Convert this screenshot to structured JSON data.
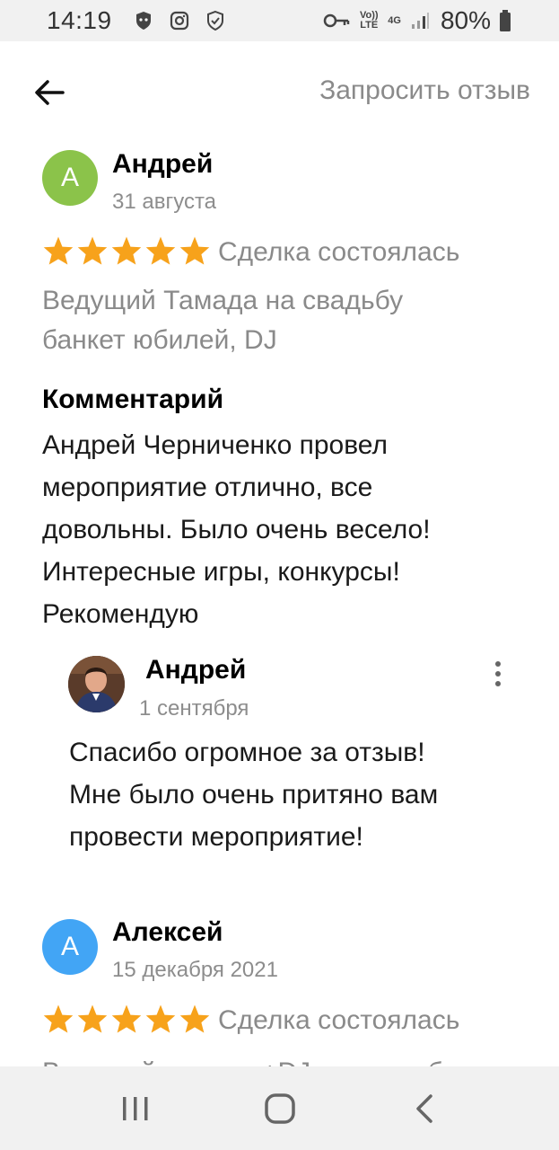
{
  "status_bar": {
    "time": "14:19",
    "network_top": "Vo)) LTE",
    "network_4g": "4G",
    "battery": "80%"
  },
  "header": {
    "request_review_label": "Запросить отзыв"
  },
  "colors": {
    "avatar_andrey": "#8bc34a",
    "avatar_aleksey": "#42a5f5",
    "star": "#f7a21b"
  },
  "reviews": [
    {
      "avatar_letter": "А",
      "author": "Андрей",
      "date": "31 августа",
      "rating": 5,
      "deal_status": "Сделка состоялась",
      "service": "Ведущий Тамада на свадьбу\nбанкет юбилей, DJ",
      "comment_heading": "Комментарий",
      "comment": "Андрей Черниченко провел\nмероприятие отлично, все\nдовольны. Было очень весело!\nИнтересные игры, конкурсы!\nРекомендую",
      "reply": {
        "author": "Андрей",
        "date": "1 сентября",
        "text": "Спасибо огромное за отзыв!\nМне было очень притяно вам\nпровести мероприятие!"
      }
    },
    {
      "avatar_letter": "А",
      "author": "Алексей",
      "date": "15 декабря 2021",
      "rating": 5,
      "deal_status": "Сделка состоялась",
      "service": "Ведущий, тамада+DJ на свадьбу"
    }
  ],
  "icons": {
    "back": "arrow-left-icon",
    "more": "more-vertical-icon",
    "nav_recent": "recent-apps-icon",
    "nav_home": "home-icon",
    "nav_back": "nav-back-icon"
  }
}
